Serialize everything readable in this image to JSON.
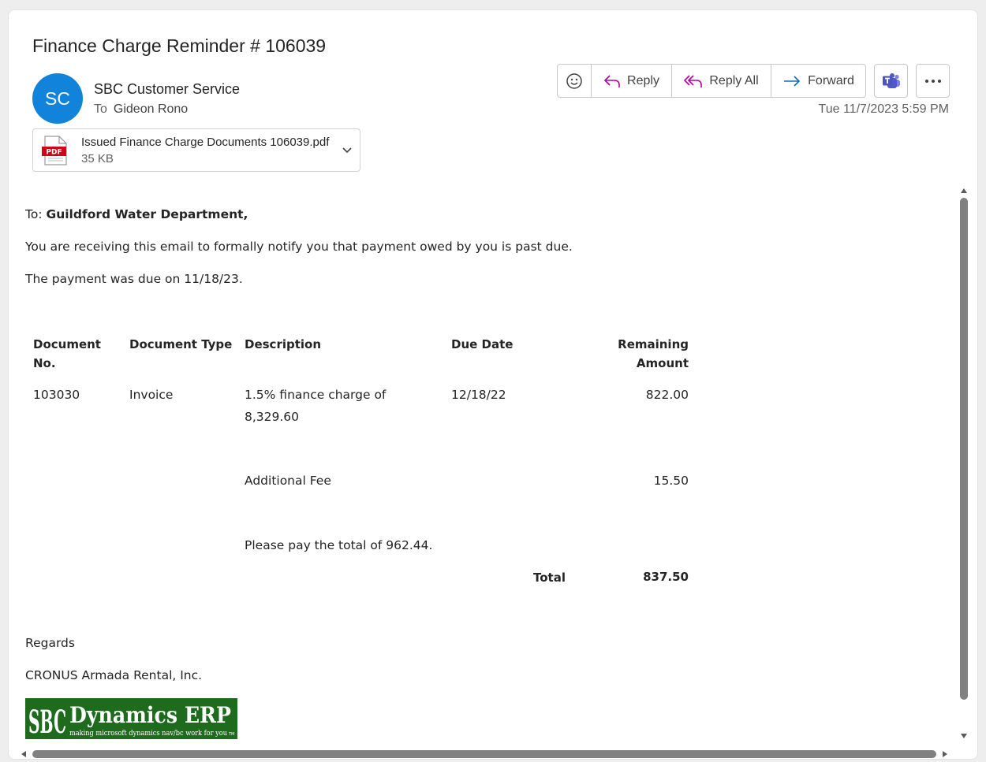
{
  "email": {
    "subject": "Finance Charge Reminder # 106039",
    "avatar_initials": "SC",
    "avatar_color": "#1183db",
    "sender_name": "SBC Customer Service",
    "to_label": "To",
    "recipient": "Gideon Rono",
    "timestamp": "Tue 11/7/2023 5:59 PM"
  },
  "attachment": {
    "icon": "pdf-file-icon",
    "file_name": "Issued Finance Charge Documents 106039.pdf",
    "file_size": "35 KB",
    "badge": "PDF"
  },
  "toolbar": {
    "emoji_icon": "smiley-icon",
    "reply_label": "Reply",
    "reply_all_label": "Reply All",
    "forward_label": "Forward",
    "teams_icon": "teams-icon",
    "more_icon": "more-icon",
    "accent": "#b4009e",
    "forward_accent": "#0f6cbd"
  },
  "body": {
    "to_prefix": "To: ",
    "to_name": "Guildford Water Department,",
    "notify": "You are receiving this email to formally notify you that payment owed by you is past due.",
    "due_line": "The payment was due on 11/18/23.",
    "regards": "Regards",
    "company": "CRONUS Armada Rental, Inc."
  },
  "table": {
    "headers": {
      "doc_no_1": "Document",
      "doc_no_2": "No.",
      "doc_type": "Document Type",
      "description": "Description",
      "due_date": "Due Date",
      "remaining_1": "Remaining",
      "remaining_2": "Amount"
    },
    "row": {
      "doc_no": "103030",
      "doc_type": "Invoice",
      "desc_1": "1.5% finance charge of",
      "desc_2": "8,329.60",
      "due_date": "12/18/22",
      "amount": "822.00"
    },
    "fee": {
      "desc": "Additional Fee",
      "amount": "15.50"
    },
    "please_pay": "Please pay the total of 962.44.",
    "total_label": "Total",
    "total_value": "837.50"
  },
  "logo": {
    "mark": "SBC",
    "title": "Dynamics ERP",
    "tagline": "making microsoft dynamics nav/bc work for you",
    "tm": "TM",
    "bg": "#1e6b1e"
  }
}
